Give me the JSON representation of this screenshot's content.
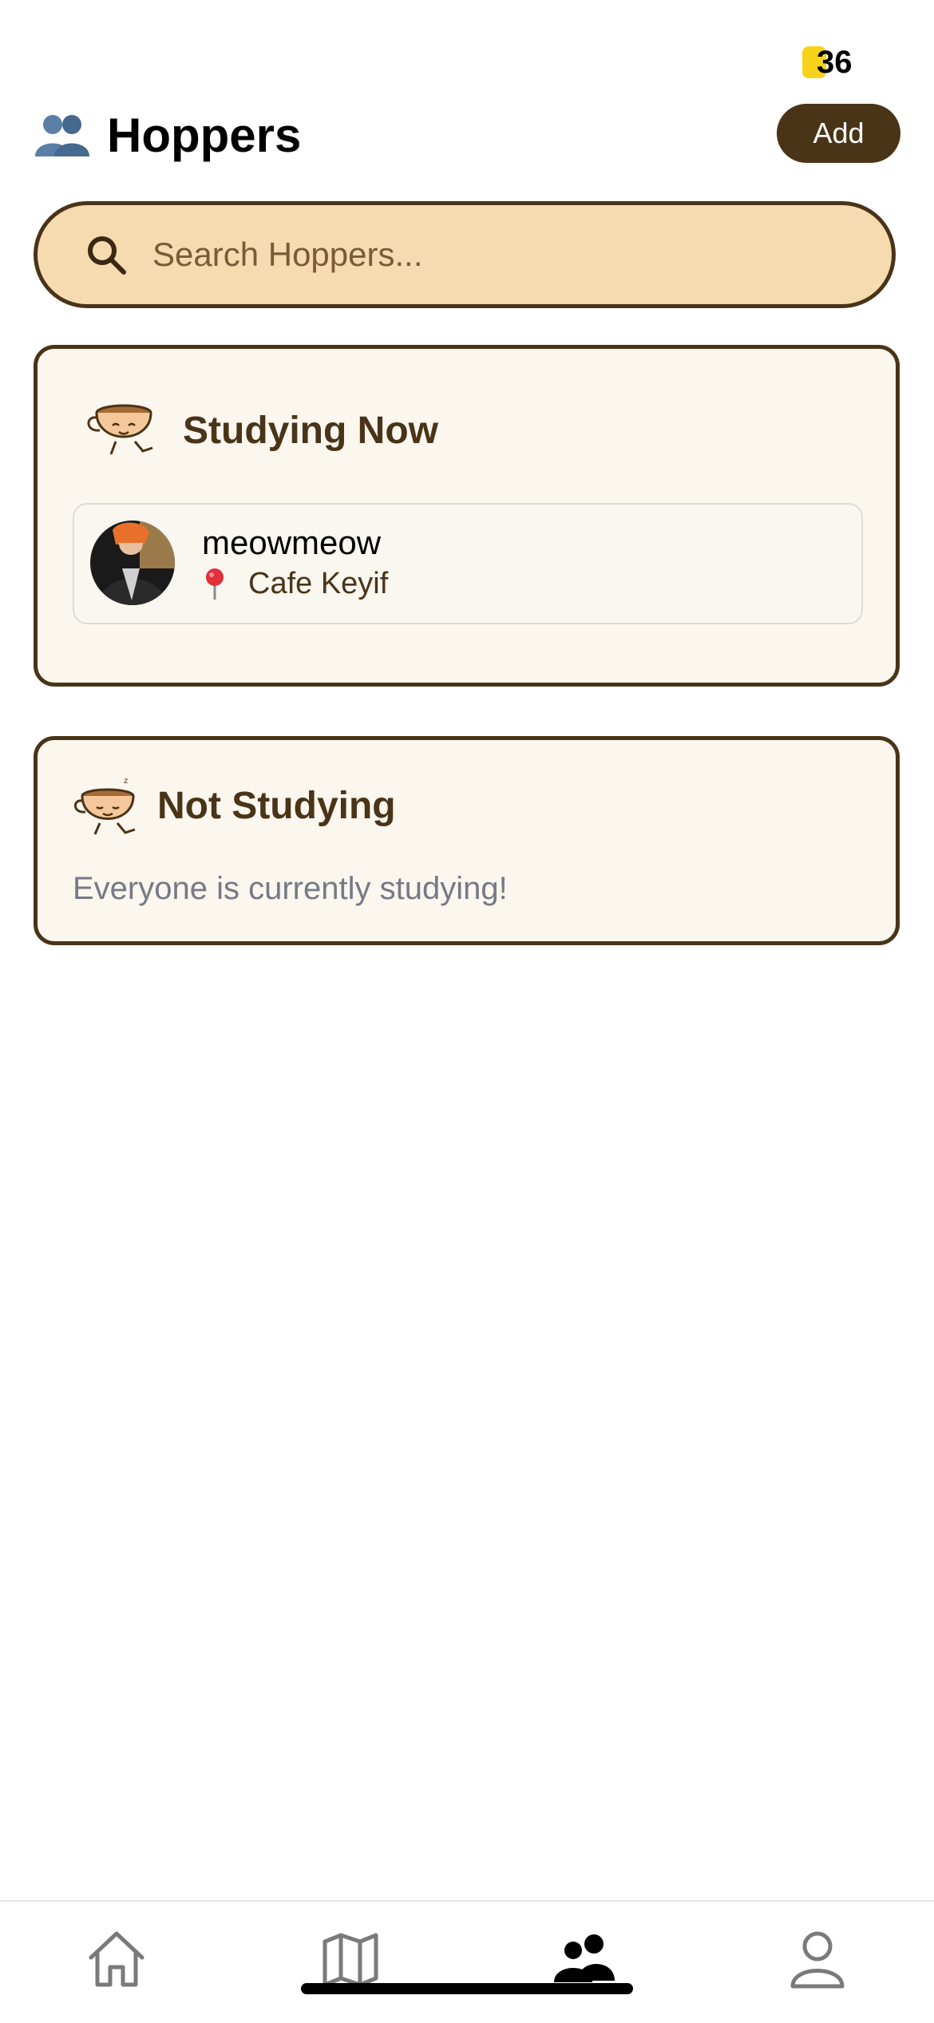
{
  "status": {
    "coin_count": "36"
  },
  "header": {
    "title": "Hoppers",
    "add_label": "Add"
  },
  "search": {
    "placeholder": "Search Hoppers..."
  },
  "studying_now": {
    "title": "Studying Now",
    "users": [
      {
        "name": "meowmeow",
        "location": "Cafe Keyif"
      }
    ]
  },
  "not_studying": {
    "title": "Not Studying",
    "empty_message": "Everyone is currently studying!"
  },
  "tabs": [
    {
      "icon": "home-icon",
      "active": false
    },
    {
      "icon": "map-icon",
      "active": false
    },
    {
      "icon": "friends-icon",
      "active": true
    },
    {
      "icon": "profile-icon",
      "active": false
    }
  ],
  "colors": {
    "brand_dark": "#4a3418",
    "search_bg": "#f6dab0",
    "card_bg": "#fbf6ee",
    "coin": "#f6d21a"
  }
}
